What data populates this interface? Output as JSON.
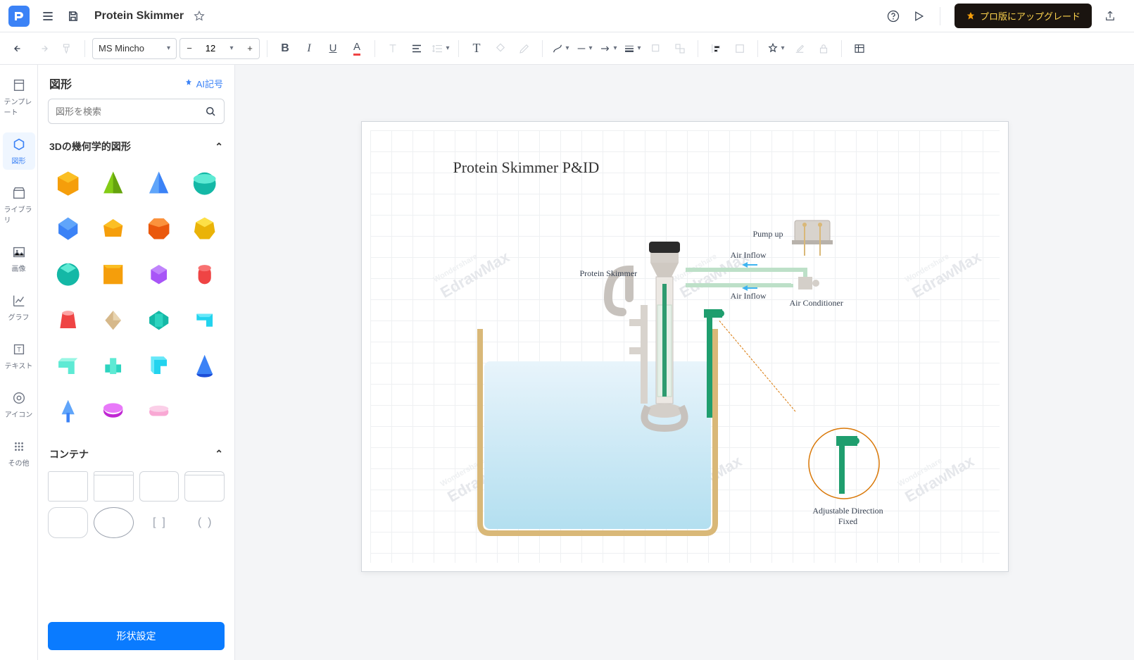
{
  "topbar": {
    "doc_title": "Protein Skimmer",
    "upgrade_label": "プロ版にアップグレード"
  },
  "toolbar": {
    "font_family": "MS Mincho",
    "font_size": "12"
  },
  "leftnav": {
    "template": "テンプレート",
    "shapes": "図形",
    "library": "ライブラリ",
    "image": "画像",
    "graph": "グラフ",
    "text": "テキスト",
    "icon": "アイコン",
    "other": "その他"
  },
  "sidebar": {
    "title": "図形",
    "ai_label": "AI記号",
    "search_placeholder": "図形を検索",
    "category_3d": "3Dの幾何学的図形",
    "category_container": "コンテナ",
    "shape_settings": "形状設定"
  },
  "diagram": {
    "title": "Protein Skimmer P&ID",
    "labels": {
      "protein_skimmer": "Protein Skimmer",
      "pump_up": "Pump up",
      "air_inflow_1": "Air Inflow",
      "air_inflow_2": "Air Inflow",
      "air_conditioner": "Air Conditioner",
      "adjustable_direction": "Adjustable Direction",
      "fixed": "Fixed"
    },
    "watermark": "EdrawMax",
    "watermark_sub": "Wondershare"
  }
}
